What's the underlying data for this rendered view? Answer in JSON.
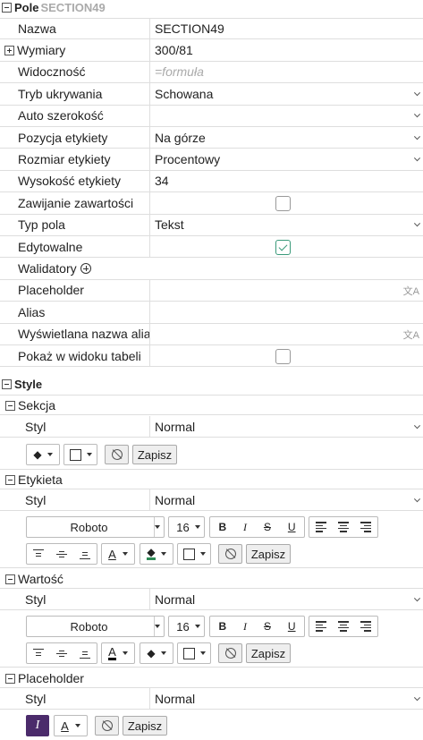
{
  "field_section": {
    "title": "Pole",
    "subtitle": "SECTION49"
  },
  "properties": [
    {
      "label": "Nazwa",
      "value": "SECTION49",
      "type": "text"
    },
    {
      "label": "Wymiary",
      "value": "300/81",
      "type": "text"
    },
    {
      "label": "Widoczność",
      "value": "=formuła",
      "type": "placeholder"
    },
    {
      "label": "Tryb ukrywania",
      "value": "Schowana",
      "type": "select"
    },
    {
      "label": "Auto szerokość",
      "value": "",
      "type": "select"
    },
    {
      "label": "Pozycja etykiety",
      "value": "Na górze",
      "type": "select"
    },
    {
      "label": "Rozmiar etykiety",
      "value": "Procentowy",
      "type": "select"
    },
    {
      "label": "Wysokość etykiety",
      "value": "34",
      "type": "text"
    },
    {
      "label": "Zawijanie zawartości",
      "checked": false,
      "type": "checkbox"
    },
    {
      "label": "Typ pola",
      "value": "Tekst",
      "type": "select"
    },
    {
      "label": "Edytowalne",
      "checked": true,
      "type": "checkbox"
    },
    {
      "label": "Walidatory",
      "type": "add"
    },
    {
      "label": "Placeholder",
      "value": "",
      "type": "translate"
    },
    {
      "label": "Alias",
      "value": "",
      "type": "text"
    },
    {
      "label": "Wyświetlana nazwa alia",
      "value": "",
      "type": "translate"
    },
    {
      "label": "Pokaż w widoku tabeli",
      "checked": false,
      "type": "checkbox"
    }
  ],
  "style_section": {
    "title": "Style"
  },
  "sekcja": {
    "title": "Sekcja",
    "style_label": "Styl",
    "style_value": "Normal",
    "save": "Zapisz"
  },
  "etykieta": {
    "title": "Etykieta",
    "style_label": "Styl",
    "style_value": "Normal",
    "font": "Roboto",
    "size": "16",
    "save": "Zapisz",
    "fill_color": "#2e8b57"
  },
  "wartosc": {
    "title": "Wartość",
    "style_label": "Styl",
    "style_value": "Normal",
    "font": "Roboto",
    "size": "16",
    "save": "Zapisz",
    "text_color": "#000000"
  },
  "placeholder_style": {
    "title": "Placeholder",
    "style_label": "Styl",
    "style_value": "Normal",
    "save": "Zapisz",
    "italic": "I"
  },
  "glyphs": {
    "bold": "B",
    "italic": "I",
    "strike": "S",
    "underline": "U",
    "text_color": "A",
    "translate": "文A"
  },
  "icons": [
    "fill-color-icon",
    "border-color-icon",
    "no-style-icon",
    "align-left-icon",
    "align-center-icon",
    "align-right-icon",
    "valign-top-icon",
    "valign-middle-icon",
    "valign-bottom-icon",
    "translate-icon",
    "add-circle-icon"
  ]
}
